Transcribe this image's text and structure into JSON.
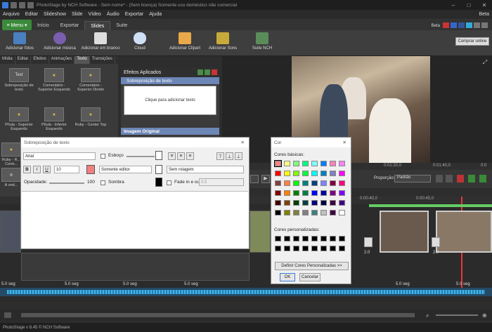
{
  "window": {
    "title": "PhotoStage by NCH Software - Sem nome* - (Sem licença) Somente uso doméstico não comercial",
    "minimize": "–",
    "maximize": "□",
    "close": "✕"
  },
  "menu": [
    "Arquivo",
    "Editar",
    "Slideshow",
    "Slide",
    "Vídeo",
    "Áudio",
    "Exportar",
    "Ajuda"
  ],
  "beta_right": "Beta",
  "ribbon_tabs": {
    "menu_button": "≡ Menu ▾",
    "tabs": [
      "Início",
      "Exportar",
      "Slides",
      "Suite"
    ],
    "active": "Slides",
    "beta": "Beta",
    "buy": "Comprar online"
  },
  "ribbon_buttons": [
    "Adicionar fotos",
    "Adicionar música",
    "Adicionar em branco",
    "Cloud",
    "Adicionar Clipart",
    "Adicionar Sons",
    "Suite NCH"
  ],
  "left_panel": {
    "subtabs": [
      "Mídia",
      "Editar",
      "Efeitos",
      "Animações",
      "Texto",
      "Transições"
    ],
    "active_subtab": "Texto",
    "items": [
      {
        "label": "Sobreposição de texto",
        "thumb": "Text"
      },
      {
        "label": "Comentário - Superior Esquerdo",
        "thumb": "★"
      },
      {
        "label": "Comentário - Superior Direito",
        "thumb": "★"
      },
      {
        "label": "Pílula - Superior Esquerdo",
        "thumb": "★"
      },
      {
        "label": "Pílula - Inferior Esquerdo",
        "thumb": "★"
      },
      {
        "label": "Ruby - Center Top",
        "thumb": "★"
      },
      {
        "label": "Ruby - R... Centr...",
        "thumb": "★"
      },
      {
        "label": "A ond...",
        "thumb": "≋"
      }
    ]
  },
  "effects_panel": {
    "title": "Efeitos Aplicados",
    "item": "Sobreposição de texto",
    "add_text": "Clique para adicionar texto",
    "original": "Imagem Original"
  },
  "preview_ruler": [
    "0:01:20,0",
    "0:01:40,0",
    "0:0"
  ],
  "preview_controls": {
    "aspect_label": "Proporção:",
    "aspect_value": "Padrão"
  },
  "timeline": {
    "ruler": [
      "0:00:40,0",
      "0:00:45,0"
    ],
    "transition_duration": "2.0",
    "clip_duration": "5.0 seg"
  },
  "text_dialog": {
    "title": "Sobreposição de texto",
    "close": "✕",
    "font": "Arial",
    "outline_label": "Esboço",
    "bold": "B",
    "italic": "I",
    "underline": "U",
    "size": "10",
    "editor_mode": "Somente editor",
    "scroll_mode": "Sem rolagem",
    "opacity_label": "Opacidade:",
    "opacity_value": "100",
    "shadow_label": "Sombra",
    "fade_label": "Fade in e out",
    "fade_value": "0.5",
    "colors": {
      "text": "#f08080",
      "outline": "#ffffff"
    }
  },
  "color_dialog": {
    "title": "Cor",
    "close": "✕",
    "basic_label": "Cores básicas:",
    "custom_label": "Cores personalizadas:",
    "define_button": "Definir Cores Personalizadas >>",
    "ok": "OK",
    "cancel": "Cancelar",
    "basic_colors": [
      "#ff8080",
      "#ffff80",
      "#80ff80",
      "#00ff80",
      "#80ffff",
      "#0080ff",
      "#ff80c0",
      "#ff80ff",
      "#ff0000",
      "#ffff00",
      "#80ff00",
      "#00ff40",
      "#00ffff",
      "#0080c0",
      "#8080c0",
      "#ff00ff",
      "#804040",
      "#ff8040",
      "#00ff00",
      "#008080",
      "#004080",
      "#8080ff",
      "#800040",
      "#ff0080",
      "#800000",
      "#ff8000",
      "#008000",
      "#008040",
      "#0000ff",
      "#0000a0",
      "#800080",
      "#8000ff",
      "#400000",
      "#804000",
      "#004000",
      "#004040",
      "#000080",
      "#000040",
      "#400040",
      "#400080",
      "#000000",
      "#808000",
      "#808040",
      "#808080",
      "#408080",
      "#c0c0c0",
      "#400040",
      "#ffffff"
    ]
  },
  "status": "PhotoStage v 8.45 © NCH Software"
}
